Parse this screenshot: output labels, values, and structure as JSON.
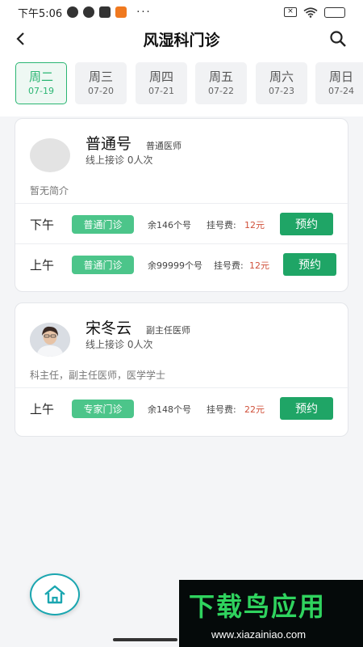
{
  "status_bar": {
    "time": "下午5:06",
    "more": "···"
  },
  "header": {
    "title": "风湿科门诊"
  },
  "day_tabs": [
    {
      "day": "周二",
      "date": "07-19",
      "active": true
    },
    {
      "day": "周三",
      "date": "07-20",
      "active": false
    },
    {
      "day": "周四",
      "date": "07-21",
      "active": false
    },
    {
      "day": "周五",
      "date": "07-22",
      "active": false
    },
    {
      "day": "周六",
      "date": "07-23",
      "active": false
    },
    {
      "day": "周日",
      "date": "07-24",
      "active": false
    }
  ],
  "doctors": [
    {
      "name": "普通号",
      "title": "普通医师",
      "consult": "线上接诊 0人次",
      "intro": "暂无简介",
      "slots": [
        {
          "period": "下午",
          "type": "普通门诊",
          "remain": "余146个号",
          "fee_label": "挂号费:",
          "fee": "12元",
          "book": "预约"
        },
        {
          "period": "上午",
          "type": "普通门诊",
          "remain": "余99999个号",
          "fee_label": "挂号费:",
          "fee": "12元",
          "book": "预约"
        }
      ]
    },
    {
      "name": "宋冬云",
      "title": "副主任医师",
      "consult": "线上接诊 0人次",
      "intro": "科主任，副主任医师，医学学士",
      "slots": [
        {
          "period": "上午",
          "type": "专家门诊",
          "remain": "余148个号",
          "fee_label": "挂号费:",
          "fee": "22元",
          "book": "预约"
        }
      ]
    }
  ],
  "watermark": {
    "title": "下载鸟应用",
    "url": "www.xiazainiao.com"
  },
  "colors": {
    "accent": "#2bb673",
    "button": "#1fa566",
    "fee": "#d0503a"
  }
}
